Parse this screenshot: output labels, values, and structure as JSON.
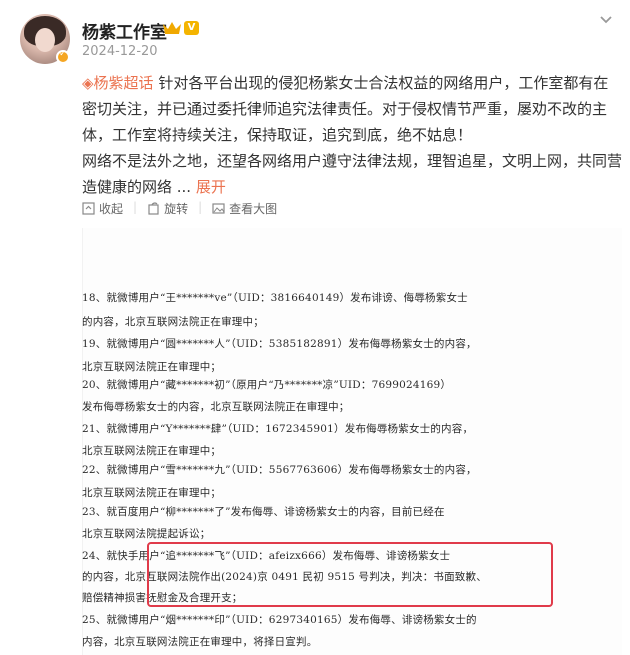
{
  "post": {
    "username": "杨紫工作室",
    "vip_badge": "V",
    "date": "2024-12-20",
    "topic": "杨紫超话",
    "body": " 针对各平台出现的侵犯杨紫女士合法权益的网络用户，工作室都有在密切关注，并已通过委托律师追究法律责任。对于侵权情节严重，屡劝不改的主体，工作室将持续关注，保持取证，追究到底，绝不姑息！",
    "body2": "网络不是法外之地，还望各网络用户遵守法律法规，理智追星，文明上网，共同营造健康的网络 ... ",
    "expand": "展开"
  },
  "actions": {
    "collapse": "收起",
    "rotate": "旋转",
    "view_large": "查看大图"
  },
  "document": {
    "lines": [
      "18、就微博用户“王*******ve”（UID：3816640149）发布诽谤、侮辱杨紫女士",
      "的内容，北京互联网法院正在审理中；",
      "19、就微博用户“圆*******人”（UID：5385182891）发布侮辱杨紫女士的内容，",
      "北京互联网法院正在审理中；",
      "20、就微博用户“藏*******初”（原用户“乃*******凉”UID：7699024169）",
      "发布侮辱杨紫女士的内容，北京互联网法院正在审理中；",
      "21、就微博用户“Y*******肆”（UID：1672345901）发布侮辱杨紫女士的内容，",
      "北京互联网法院正在审理中；",
      "22、就微博用户“雪*******九”（UID：5567763606）发布侮辱杨紫女士的内容，",
      "北京互联网法院正在审理中；",
      "23、就百度用户“柳*******了”发布侮辱、诽谤杨紫女士的内容，目前已经在",
      "北京互联网法院提起诉讼；",
      "24、就快手用户“追*******飞”（UID：afeizx666）发布侮辱、诽谤杨紫女士",
      "的内容，北京互联网法院作出(2024)京 0491 民初 9515 号判决，判决：书面致歉、",
      "赔偿精神损害抚慰金及合理开支；",
      "25、就微博用户“烟*******印”（UID：6297340165）发布侮辱、诽谤杨紫女士的",
      "内容，北京互联网法院正在审理中，将择日宣判。"
    ]
  },
  "colors": {
    "topic": "#eb7350",
    "highlight_box": "#e03b4a"
  },
  "icons": [
    "chevron-down-icon",
    "collapse-icon",
    "rotate-icon",
    "view-large-icon",
    "topic-diamond-icon",
    "crown-icon",
    "verified-icon"
  ]
}
